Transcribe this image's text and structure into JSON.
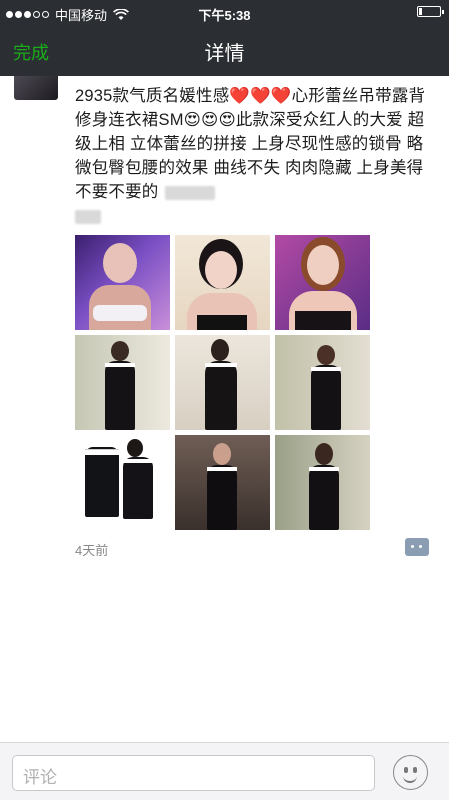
{
  "status_bar": {
    "carrier": "中国移动",
    "time": "下午5:38"
  },
  "nav": {
    "done_label": "完成",
    "title": "详情"
  },
  "post": {
    "text": "2935款气质名媛性感❤️❤️❤️心形蕾丝吊带露背修身连衣裙SM😍😍😍此款深受众红人的大爱 超级上相 立体蕾丝的拼接 上身尽现性感的锁骨 略微包臀包腰的效果 曲线不失 肉肉隐藏 上身美得不要不要的",
    "time_ago": "4天前",
    "images": [
      "photo-1",
      "photo-2",
      "photo-3",
      "photo-4",
      "photo-5",
      "photo-6",
      "photo-7",
      "photo-8",
      "photo-9"
    ]
  },
  "comment_bar": {
    "placeholder": "评论"
  },
  "colors": {
    "nav_bg": "#2b2e33",
    "accent_green": "#1aad19",
    "comment_icon": "#8b9db3"
  }
}
